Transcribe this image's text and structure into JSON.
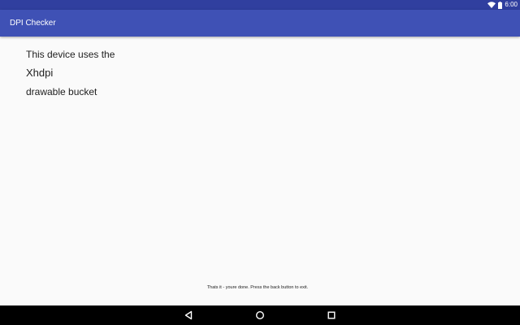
{
  "status_bar": {
    "time": "6:00",
    "icons": [
      "wifi-icon",
      "battery-icon"
    ],
    "color": "#303f9f"
  },
  "app_bar": {
    "title": "DPI Checker",
    "color": "#3f51b5"
  },
  "content": {
    "line1": "This device uses the",
    "line2": "Xhdpi",
    "line3": "drawable bucket"
  },
  "footer": {
    "note": "Thats it - youre done. Press the back button to exit."
  },
  "nav_bar": {
    "buttons": [
      "back-icon",
      "home-icon",
      "recents-icon"
    ]
  }
}
